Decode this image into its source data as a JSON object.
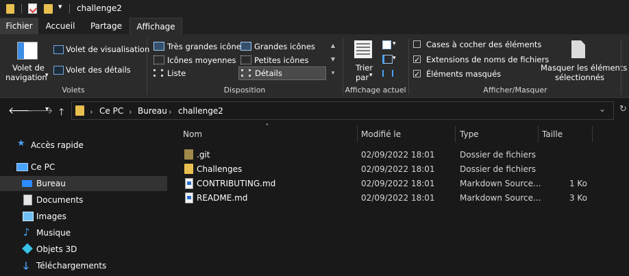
{
  "window": {
    "title": "challenge2"
  },
  "tabs": [
    "Fichier",
    "Accueil",
    "Partage",
    "Affichage"
  ],
  "ribbon": {
    "volets": {
      "nav_pane_label_line1": "Volet de",
      "nav_pane_label_line2": "navigation",
      "preview_pane": "Volet de visualisation",
      "details_pane": "Volet des détails",
      "group": "Volets"
    },
    "disposition": {
      "items": [
        "Très grandes icônes",
        "Grandes icônes",
        "Icônes moyennes",
        "Petites icônes",
        "Liste",
        "Détails"
      ],
      "selected": "Détails",
      "group": "Disposition"
    },
    "affichage_actuel": {
      "sort_label_line1": "Trier",
      "sort_label_line2": "par",
      "group": "Affichage actuel"
    },
    "afficher_masquer": {
      "checkboxes": [
        {
          "label": "Cases à cocher des éléments",
          "checked": false
        },
        {
          "label": "Extensions de noms de fichiers",
          "checked": true
        },
        {
          "label": "Éléments masqués",
          "checked": true
        }
      ],
      "hide_selected_line1": "Masquer les éléments",
      "hide_selected_line2": "sélectionnés",
      "group": "Afficher/Masquer"
    }
  },
  "address": {
    "path": [
      "Ce PC",
      "Bureau",
      "challenge2"
    ]
  },
  "columns": [
    "Nom",
    "Modifié le",
    "Type",
    "Taille"
  ],
  "files": [
    {
      "name": ".git",
      "modified": "02/09/2022 18:01",
      "type": "Dossier de fichiers",
      "size": "",
      "kind": "folder-dark"
    },
    {
      "name": "Challenges",
      "modified": "02/09/2022 18:01",
      "type": "Dossier de fichiers",
      "size": "",
      "kind": "folder"
    },
    {
      "name": "CONTRIBUTING.md",
      "modified": "02/09/2022 18:01",
      "type": "Markdown Source...",
      "size": "1 Ko",
      "kind": "md"
    },
    {
      "name": "README.md",
      "modified": "02/09/2022 18:01",
      "type": "Markdown Source...",
      "size": "3 Ko",
      "kind": "md"
    }
  ],
  "sidebar": {
    "items": [
      {
        "label": "Accès rapide",
        "icon": "star-icon"
      },
      {
        "label": "Ce PC",
        "icon": "computer-icon"
      },
      {
        "label": "Bureau",
        "icon": "desktop-icon",
        "selected": true
      },
      {
        "label": "Documents",
        "icon": "documents-icon"
      },
      {
        "label": "Images",
        "icon": "pictures-icon"
      },
      {
        "label": "Musique",
        "icon": "music-icon"
      },
      {
        "label": "Objets 3D",
        "icon": "3d-objects-icon"
      },
      {
        "label": "Téléchargements",
        "icon": "downloads-icon"
      }
    ]
  },
  "colors": {
    "background": "#191919",
    "ribbon": "#2b2b2b",
    "accent": "#4aa3ff",
    "folder": "#e9bf4f"
  }
}
